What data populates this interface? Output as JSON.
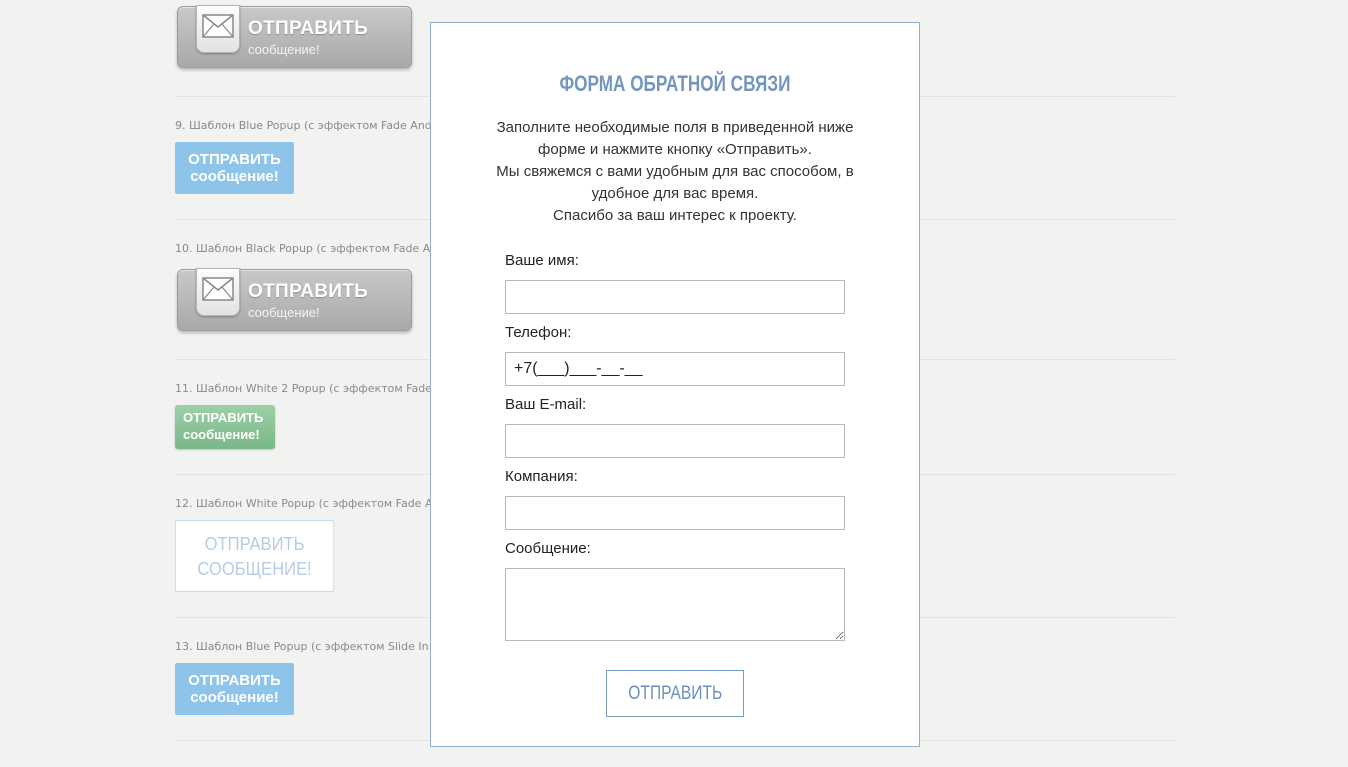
{
  "background": {
    "gray_button_1": {
      "line1": "ОТПРАВИТЬ",
      "line2": "сообщение!"
    },
    "sections": [
      {
        "label": "9. Шаблон Blue Popup (с эффектом Fade And",
        "button_line1": "ОТПРАВИТЬ",
        "button_line2": "сообщение!"
      },
      {
        "label": "10. Шаблон Black Popup (с эффектом Fade A",
        "button_line1": "ОТПРАВИТЬ",
        "button_line2": "сообщение!"
      },
      {
        "label": "11. Шаблон White 2 Popup (с эффектом Fade",
        "button_line1": "ОТПРАВИТЬ",
        "button_line2": "сообщение!"
      },
      {
        "label": "12. Шаблон White Popup (с эффектом Fade A",
        "button_line1": "ОТПРАВИТЬ",
        "button_line2": "СООБЩЕНИЕ!"
      },
      {
        "label": "13. Шаблон Blue Popup (с эффектом Slide In",
        "button_line1": "ОТПРАВИТЬ",
        "button_line2": "сообщение!"
      }
    ]
  },
  "modal": {
    "title": "ФОРМА ОБРАТНОЙ СВЯЗИ",
    "intro_lines": [
      "Заполните необходимые поля в приведенной ниже",
      "форме и нажмите кнопку «Отправить».",
      "Мы свяжемся с вами удобным для вас способом, в",
      "удобное для вас время.",
      "Спасибо за ваш интерес к проекту."
    ],
    "fields": {
      "name_label": "Ваше имя:",
      "name_value": "",
      "phone_label": "Телефон:",
      "phone_value": "+7(___)___-__-__",
      "email_label": "Ваш E-mail:",
      "email_value": "",
      "company_label": "Компания:",
      "company_value": "",
      "message_label": "Сообщение:",
      "message_value": ""
    },
    "submit_label": "ОТПРАВИТЬ"
  },
  "colors": {
    "page_bg": "#f2f2f0",
    "modal_border": "#8fb0d4",
    "title_color": "#7496be",
    "blue_button": "#8ec4ea",
    "green_button": "#79b788"
  },
  "icons": [
    "envelope-icon"
  ]
}
